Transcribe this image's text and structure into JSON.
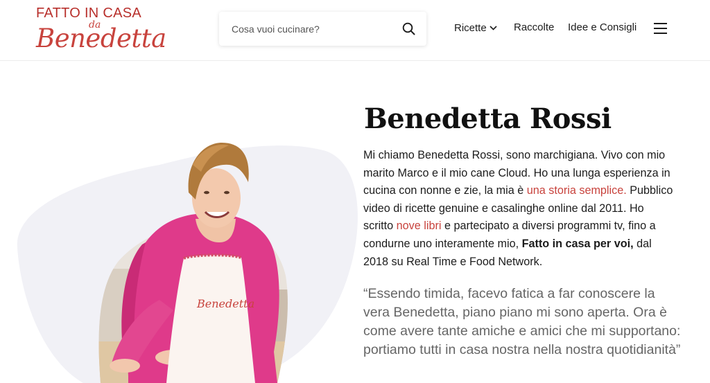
{
  "brand": {
    "logo_top": "FATTO IN CASA",
    "logo_da": "da",
    "logo_script": "Benedetta",
    "accent_color": "#c8433d"
  },
  "search": {
    "placeholder": "Cosa vuoi cucinare?",
    "value": "",
    "icon": "search-icon"
  },
  "nav": {
    "items": [
      {
        "label": "Ricette",
        "has_dropdown": true
      },
      {
        "label": "Raccolte"
      },
      {
        "label": "Idee e Consigli"
      }
    ],
    "menu_icon": "hamburger-icon"
  },
  "hero": {
    "title": "Benedetta Rossi",
    "bio": {
      "p1": "Mi chiamo Benedetta Rossi, sono marchigiana. Vivo con mio marito Marco e il mio cane Cloud. Ho una lunga esperienza in cucina con nonne e zie, la mia è ",
      "link1": "una storia semplice.",
      "p2": " Pubblico video di ricette genuine e casalinghe online dal 2011. Ho scritto ",
      "link2": "nove libri",
      "p3": " e partecipato a diversi programmi tv, fino a condurne uno interamente mio, ",
      "show": "Fatto in casa per voi,",
      "p4": " dal 2018 su Real Time e Food Network."
    },
    "quote": "“Essendo timida, facevo fatica a far conoscere la vera Benedetta, piano piano mi sono aperta. Ora è come avere tante amiche e amici che mi supportano: portiamo tutti in casa nostra nella nostra quotidianità”",
    "apron_text": "Benedetta"
  }
}
